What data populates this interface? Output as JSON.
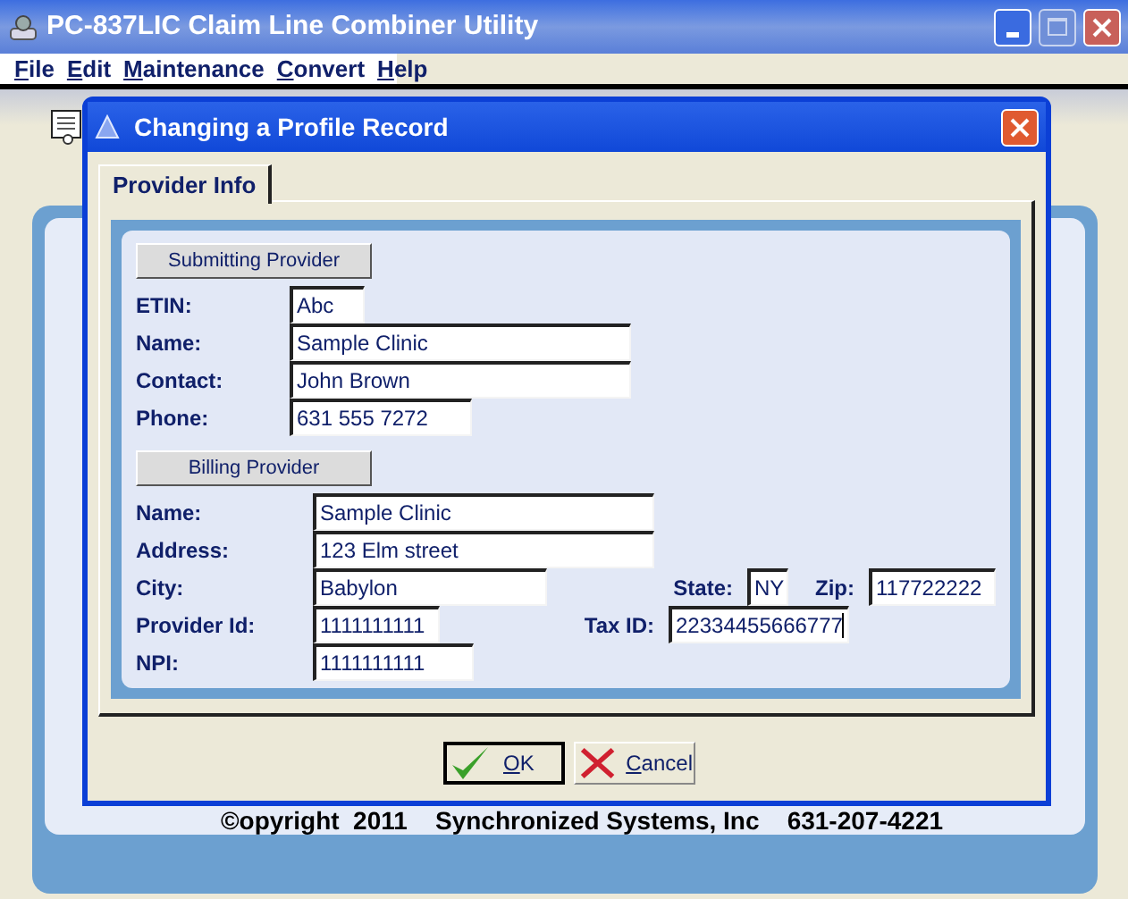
{
  "window": {
    "title": "PC-837LIC Claim Line Combiner Utility"
  },
  "menu": [
    {
      "label": "File"
    },
    {
      "label": "Edit"
    },
    {
      "label": "Maintenance"
    },
    {
      "label": "Convert"
    },
    {
      "label": "Help"
    }
  ],
  "dialog": {
    "title": "Changing a Profile Record",
    "tabs": [
      {
        "label": "Provider Info",
        "selected": true
      }
    ],
    "sections": [
      {
        "heading": "Submitting Provider",
        "rows": [
          [
            {
              "label": "ETIN:",
              "value": "Abc",
              "focused": false
            }
          ],
          [
            {
              "label": "Name:",
              "value": "Sample Clinic",
              "focused": false
            }
          ],
          [
            {
              "label": "Contact:",
              "value": "John Brown",
              "focused": false
            }
          ],
          [
            {
              "label": "Phone:",
              "value": "631 555 7272",
              "focused": false
            }
          ]
        ]
      },
      {
        "heading": "Billing Provider",
        "rows": [
          [
            {
              "label": "Name:",
              "value": "Sample Clinic",
              "focused": false
            }
          ],
          [
            {
              "label": "Address:",
              "value": "123 Elm street",
              "focused": false
            }
          ],
          [
            {
              "label": "City:",
              "value": "Babylon",
              "focused": false
            },
            {
              "label": "State:",
              "value": "NY",
              "focused": false
            },
            {
              "label": "Zip:",
              "value": "117722222",
              "focused": false
            }
          ],
          [
            {
              "label": "Provider Id:",
              "value": "1111111111",
              "focused": false
            },
            {
              "label": "Tax ID:",
              "value": "22334455666777",
              "focused": true
            }
          ],
          [
            {
              "label": "NPI:",
              "value": "1111111111",
              "focused": false
            }
          ]
        ]
      }
    ],
    "buttons": [
      {
        "kind": "ok",
        "label": "OK"
      },
      {
        "kind": "cancel",
        "label": "Cancel"
      }
    ]
  },
  "footer": "©opyright  2011    Synchronized Systems, Inc    631-207-4221"
}
